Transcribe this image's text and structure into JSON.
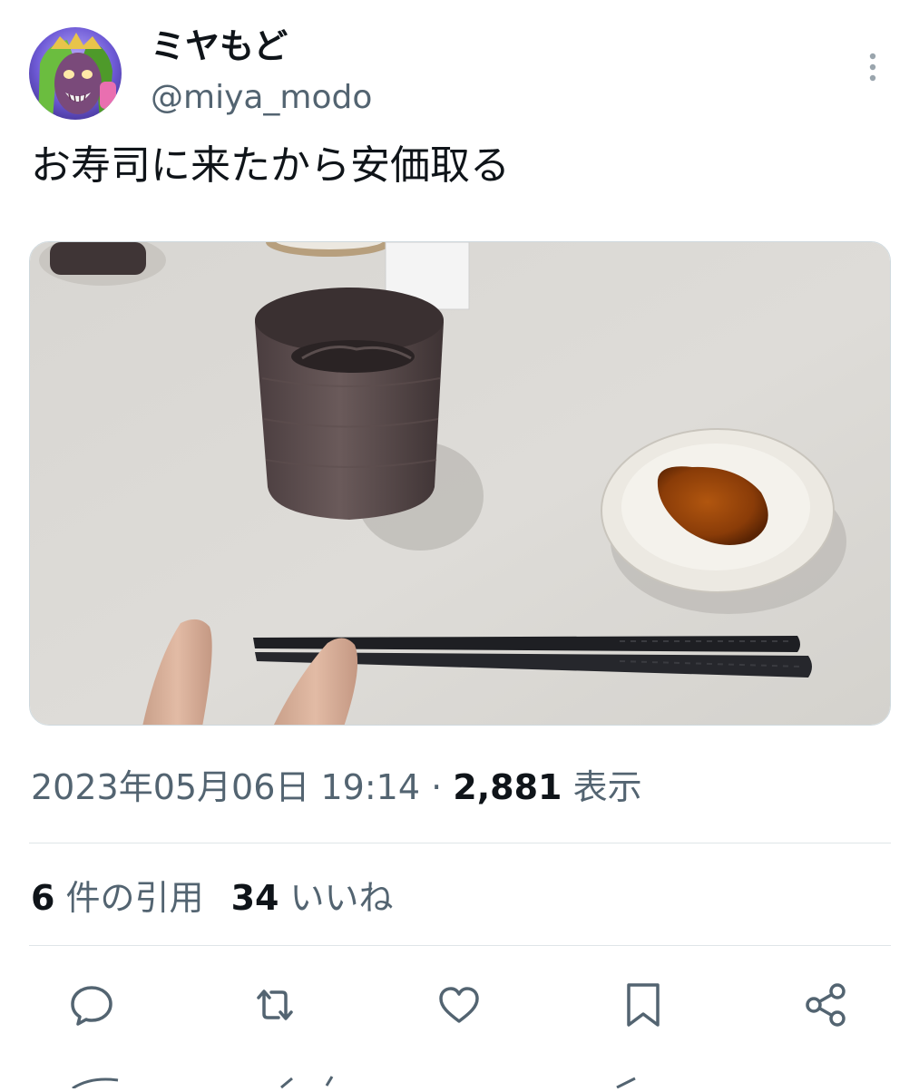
{
  "tweet": {
    "author": {
      "display_name": "ミヤもど",
      "handle": "@miya_modo",
      "avatar_icon": "avatar-illustration-icon"
    },
    "text": "お寿司に来たから安価取る",
    "media": {
      "icon": "photo-sushi-table",
      "colors": {
        "table": "#dcdad5",
        "cup": "#5a4a4a",
        "soy_sauce": "#8a3c08",
        "plate": "#f1efe9",
        "chopsticks": "#1e1f23"
      }
    },
    "meta": {
      "datetime": "2023年05月06日 19:14",
      "separator": "·",
      "views_count": "2,881",
      "views_label": "表示"
    },
    "stats": {
      "quotes_count": "6",
      "quotes_label": "件の引用",
      "likes_count": "34",
      "likes_label": "いいね"
    },
    "actions": [
      {
        "name": "reply",
        "icon": "reply-icon"
      },
      {
        "name": "retweet",
        "icon": "retweet-icon"
      },
      {
        "name": "like",
        "icon": "heart-icon"
      },
      {
        "name": "bookmark",
        "icon": "bookmark-icon"
      },
      {
        "name": "share",
        "icon": "share-icon"
      }
    ]
  },
  "colors": {
    "text_primary": "#0f1419",
    "text_secondary": "#536471",
    "divider": "#dfe5e8"
  }
}
